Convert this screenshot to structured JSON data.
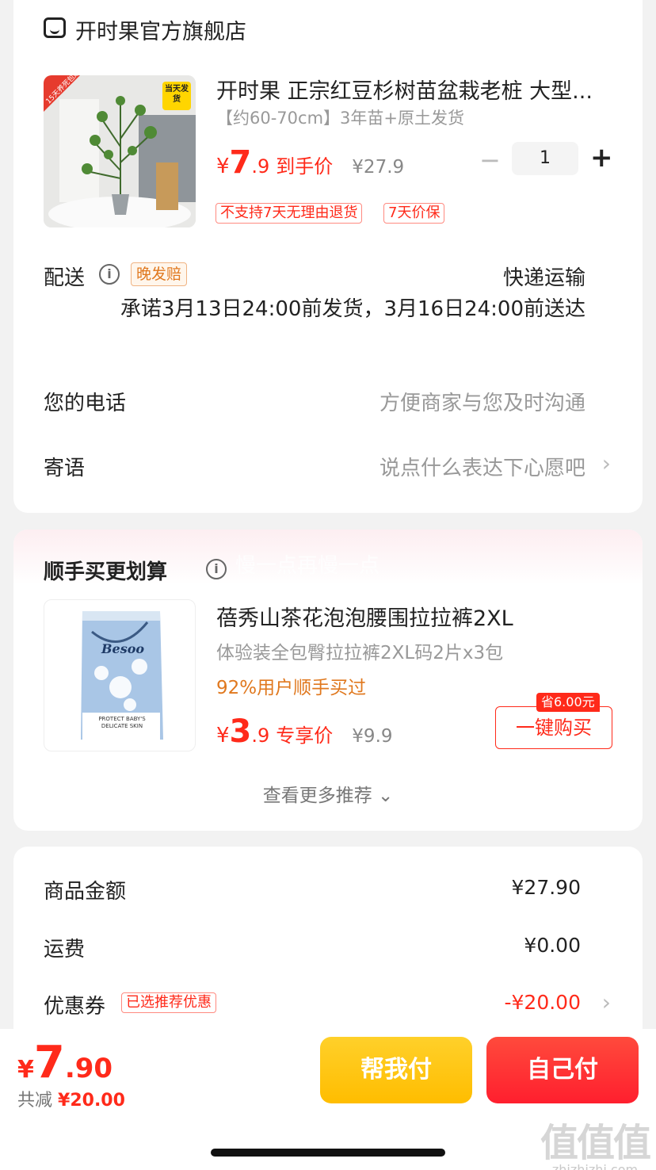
{
  "shop": {
    "icon": "store-icon",
    "name": "开时果官方旗舰店"
  },
  "product": {
    "image_badges": {
      "corner": "15天养死包赔",
      "tag": "当天发货"
    },
    "title": "开时果 正宗红豆杉树苗盆栽老桩 大型...",
    "spec": "【约60-70cm】3年苗+原土发货",
    "price_currency": "¥",
    "price_int": "7",
    "price_dec": ".9",
    "price_label": "到手价",
    "original_price": "¥27.9",
    "quantity": "1",
    "qty_minus": "−",
    "qty_plus": "+",
    "tags": [
      "不支持7天无理由退货",
      "7天价保"
    ]
  },
  "delivery": {
    "label": "配送",
    "info_icon": "i",
    "late_badge": "晚发赔",
    "type": "快递运输",
    "promise": "承诺3月13日24:00前发货，3月16日24:00前送达"
  },
  "phone": {
    "label": "您的电话",
    "placeholder": "方便商家与您及时沟通"
  },
  "message": {
    "label": "寄语",
    "placeholder": "说点什么表达下心愿吧",
    "chevron": "›"
  },
  "addon": {
    "title": "顺手买更划算",
    "info_icon": "i",
    "watermark": "慢一点再慢一点",
    "product_image_brand": "Besoo",
    "product_image_caption": "PROTECT BABY'S DELICATE SKIN",
    "name": "蓓秀山茶花泡泡腰围拉拉裤2XL",
    "sub": "体验装全包臀拉拉裤2XL码2片x3包",
    "bought_pct": "92%用户顺手买过",
    "price_currency": "¥",
    "price_int": "3",
    "price_dec": ".9",
    "price_label": "专享价",
    "original_price": "¥9.9",
    "save_badge": "省6.00元",
    "buy_button": "一键购买",
    "see_more": "查看更多推荐 ⌄"
  },
  "cost": {
    "items": [
      {
        "label": "商品金额",
        "value": "¥27.90"
      },
      {
        "label": "运费",
        "value": "¥0.00"
      },
      {
        "label": "优惠券",
        "value": "-¥20.00"
      }
    ],
    "coupon_tag": "已选推荐优惠",
    "chevron": "›"
  },
  "footer": {
    "total_currency": "¥",
    "total_int": "7",
    "total_dec": ".90",
    "discount_label": "共减",
    "discount_value": "¥20.00",
    "help_pay": "帮我付",
    "self_pay": "自己付"
  },
  "watermark": {
    "logo": "值值值",
    "url": "zhizhizhi.com"
  },
  "colors": {
    "accent": "#ff2a1a",
    "orange": "#e0781e",
    "yellow": "#ffc400"
  }
}
